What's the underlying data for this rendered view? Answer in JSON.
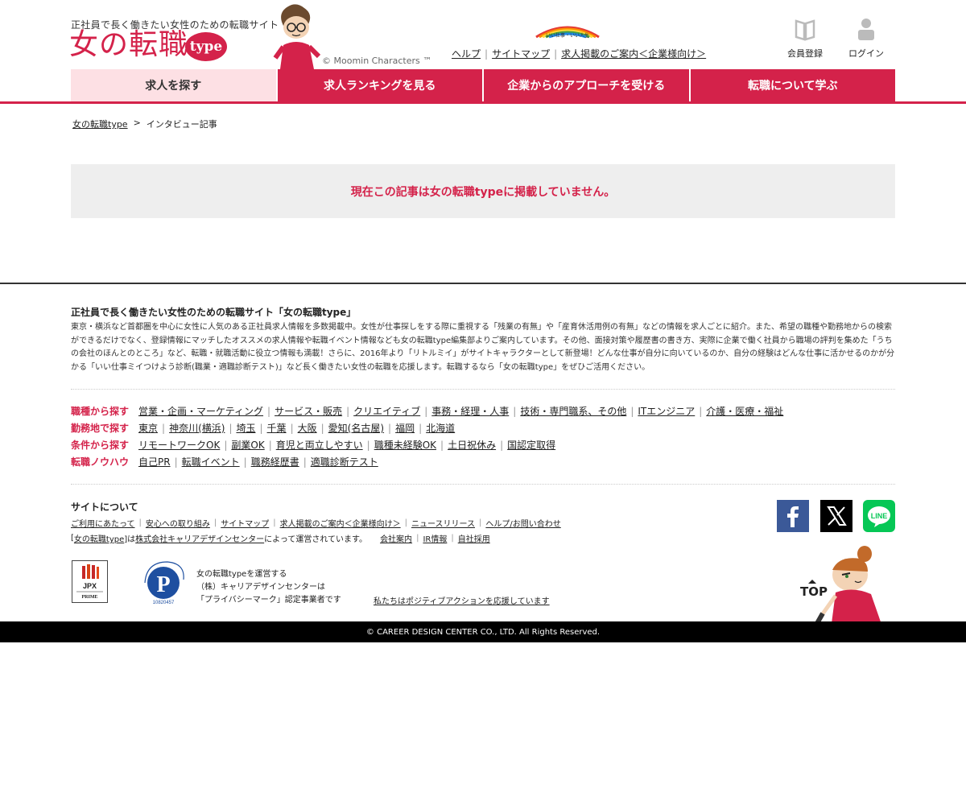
{
  "header": {
    "tagline": "正社員で長く働きたい女性のための転職サイト",
    "logo_text": "女の転職",
    "logo_badge": "type",
    "mascot_copyright": "© Moomin Characters ™",
    "rainbow_caption": "いい仕事・いい人生",
    "links": [
      "ヘルプ",
      "サイトマップ",
      "求人掲載のご案内＜企業様向け＞"
    ],
    "register_label": "会員登録",
    "login_label": "ログイン"
  },
  "nav": {
    "items": [
      "求人を探す",
      "求人ランキングを見る",
      "企業からのアプローチを受ける",
      "転職について学ぶ"
    ],
    "active_index": 0
  },
  "breadcrumb": {
    "home": "女の転職type",
    "separator": ">",
    "current": "インタビュー記事"
  },
  "notice": {
    "message": "現在この記事は女の転職typeに掲載していません。"
  },
  "footer": {
    "title": "正社員で長く働きたい女性のための転職サイト「女の転職type」",
    "description": "東京・横浜など首都圏を中心に女性に人気のある正社員求人情報を多数掲載中。女性が仕事探しをする際に重視する「残業の有無」や「産育休活用例の有無」などの情報を求人ごとに紹介。また、希望の職種や勤務地からの検索ができるだけでなく、登録情報にマッチしたオススメの求人情報や転職イベント情報なども女の転職type編集部よりご案内しています。その他、面接対策や履歴書の書き方、実際に企業で働く社員から職場の評判を集めた「うちの会社のほんとのところ」など、転職・就職活動に役立つ情報も満載！さらに、2016年より「リトルミイ」がサイトキャラクターとして新登場！どんな仕事が自分に向いているのか、自分の経験はどんな仕事に活かせるのかが分かる「いい仕事ミイつけよう診断(職業・適職診断テスト)」など長く働きたい女性の転職を応援します。転職するなら「女の転職type」をぜひご活用ください。",
    "categories": [
      {
        "label": "職種から探す",
        "links": [
          "営業・企画・マーケティング",
          "サービス・販売",
          "クリエイティブ",
          "事務・経理・人事",
          "技術・専門職系、その他",
          "ITエンジニア",
          "介護・医療・福祉"
        ]
      },
      {
        "label": "勤務地で探す",
        "links": [
          "東京",
          "神奈川(横浜)",
          "埼玉",
          "千葉",
          "大阪",
          "愛知(名古屋)",
          "福岡",
          "北海道"
        ]
      },
      {
        "label": "条件から探す",
        "links": [
          "リモートワークOK",
          "副業OK",
          "育児と両立しやすい",
          "職種未経験OK",
          "土日祝休み",
          "国認定取得"
        ]
      },
      {
        "label": "転職ノウハウ",
        "links": [
          "自己PR",
          "転職イベント",
          "職務経歴書",
          "適職診断テスト"
        ]
      }
    ],
    "site_title": "サイトについて",
    "site_links": [
      "ご利用にあたって",
      "安心への取り組み",
      "サイトマップ",
      "求人掲載のご案内＜企業様向け＞",
      "ニュースリリース",
      "ヘルプ/お問い合わせ"
    ],
    "operator_prefix": "[",
    "operator_site": "女の転職type",
    "operator_mid": "]は",
    "operator_company": "株式会社キャリアデザインセンター",
    "operator_suffix": "によって運営されています。",
    "company_links": [
      "会社案内",
      "IR情報",
      "自社採用"
    ],
    "jpx_label": "JPX",
    "jpx_sub": "PRIME",
    "pmark_number": "10820457",
    "pmark_text": [
      "女の転職typeを運営する",
      "（株）キャリアデザインセンターは",
      "「プライバシーマーク」認定事業者です"
    ],
    "positive_action": "私たちはポジティブアクションを応援しています",
    "top_label": "TOP",
    "copyright": "© CAREER DESIGN CENTER CO., LTD. All Rights Reserved."
  },
  "social": {
    "facebook_color": "#3b5998",
    "x_color": "#000000",
    "line_color": "#06c755"
  },
  "colors": {
    "brand": "#d4224a",
    "nav_active_bg": "#fde0e4",
    "notice_bg": "#eeeeee"
  }
}
